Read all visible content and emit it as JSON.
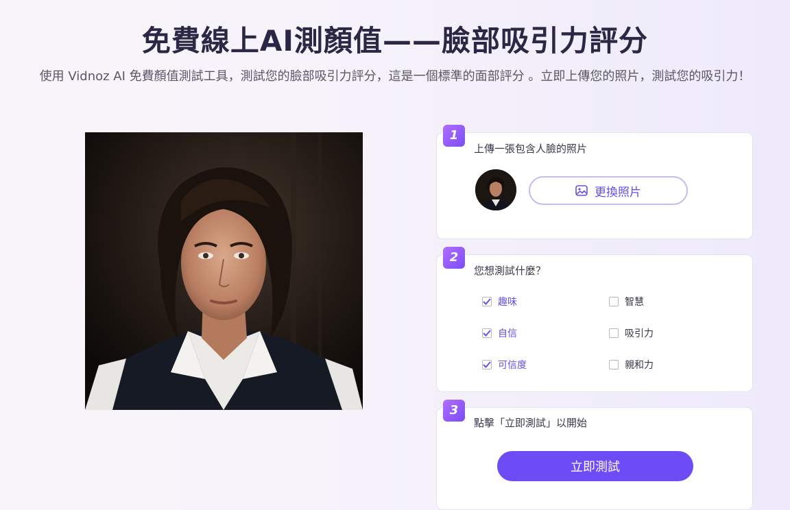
{
  "header": {
    "title": "免費線上AI測顏值——臉部吸引力評分",
    "subtitle": "使用 Vidnoz AI 免費顏值測試工具，測試您的臉部吸引力評分，這是一個標準的面部評分 。立即上傳您的照片，測試您的吸引力！"
  },
  "steps": [
    {
      "number": "1",
      "label": "上傳一張包含人臉的照片",
      "replace_button": "更換照片"
    },
    {
      "number": "2",
      "label": "您想測試什麼？",
      "options": [
        {
          "label": "趣味",
          "checked": true
        },
        {
          "label": "智慧",
          "checked": false
        },
        {
          "label": "自信",
          "checked": true
        },
        {
          "label": "吸引力",
          "checked": false
        },
        {
          "label": "可信度",
          "checked": true
        },
        {
          "label": "親和力",
          "checked": false
        }
      ]
    },
    {
      "number": "3",
      "label": "點擊「立即測試」以開始",
      "start_button": "立即測試"
    }
  ],
  "colors": {
    "accent": "#6d4cf6",
    "badge_from": "#b26dff",
    "badge_to": "#7a4df5",
    "title": "#2b2744"
  },
  "icons": {
    "replace": "image-icon",
    "check": "check-icon"
  }
}
